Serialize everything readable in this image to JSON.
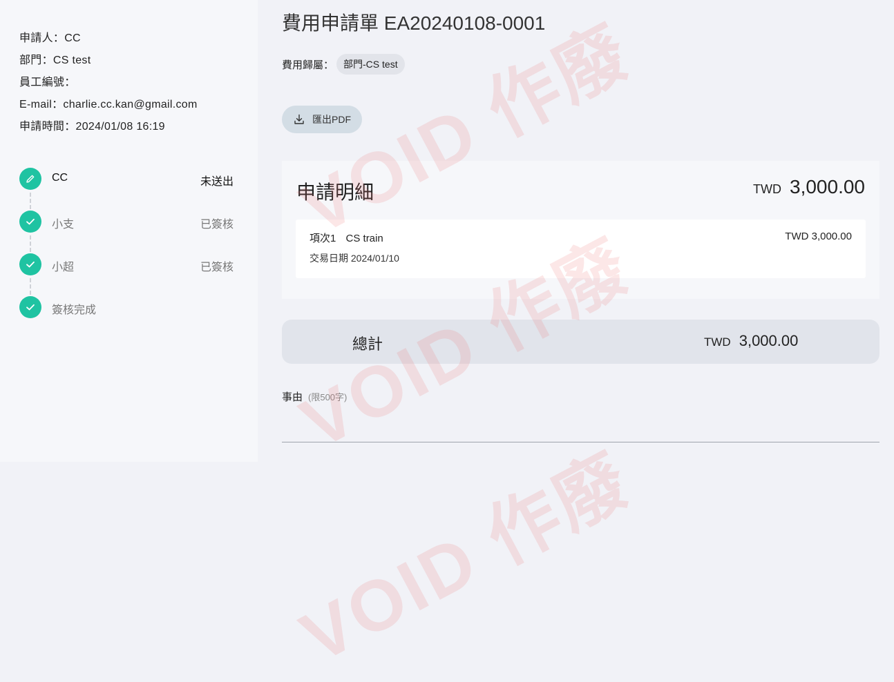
{
  "applicant": {
    "name_line": "申請人：CC",
    "dept_line": "部門：CS test",
    "emp_no_line": "員工編號：",
    "email_line": "E-mail：charlie.cc.kan@gmail.com",
    "time_line": "申請時間：2024/01/08 16:19"
  },
  "steps": [
    {
      "name": "CC",
      "status": "未送出",
      "icon": "pencil-icon"
    },
    {
      "name": "小支",
      "status": "已簽核",
      "icon": "check-icon"
    },
    {
      "name": "小超",
      "status": "已簽核",
      "icon": "check-icon"
    },
    {
      "name": "簽核完成",
      "status": "",
      "icon": "check-icon"
    }
  ],
  "form": {
    "title": "費用申請單 EA20240108-0001",
    "belong_label": "費用歸屬：",
    "belong_value": "部門-CS test",
    "export_label": "匯出PDF"
  },
  "detail": {
    "heading": "申請明細",
    "currency": "TWD",
    "amount": "3,000.00",
    "items": [
      {
        "index": "項次1",
        "name": "CS train",
        "date": "交易日期 2024/01/10",
        "amount": "TWD 3,000.00"
      }
    ]
  },
  "total": {
    "label": "總計",
    "currency": "TWD",
    "amount": "3,000.00"
  },
  "reason": {
    "label": "事由",
    "hint": "(限500字)"
  },
  "watermark": {
    "text": "VOID 作廢",
    "color": "#f06e6e"
  },
  "colors": {
    "accent": "#1fc3a2"
  }
}
